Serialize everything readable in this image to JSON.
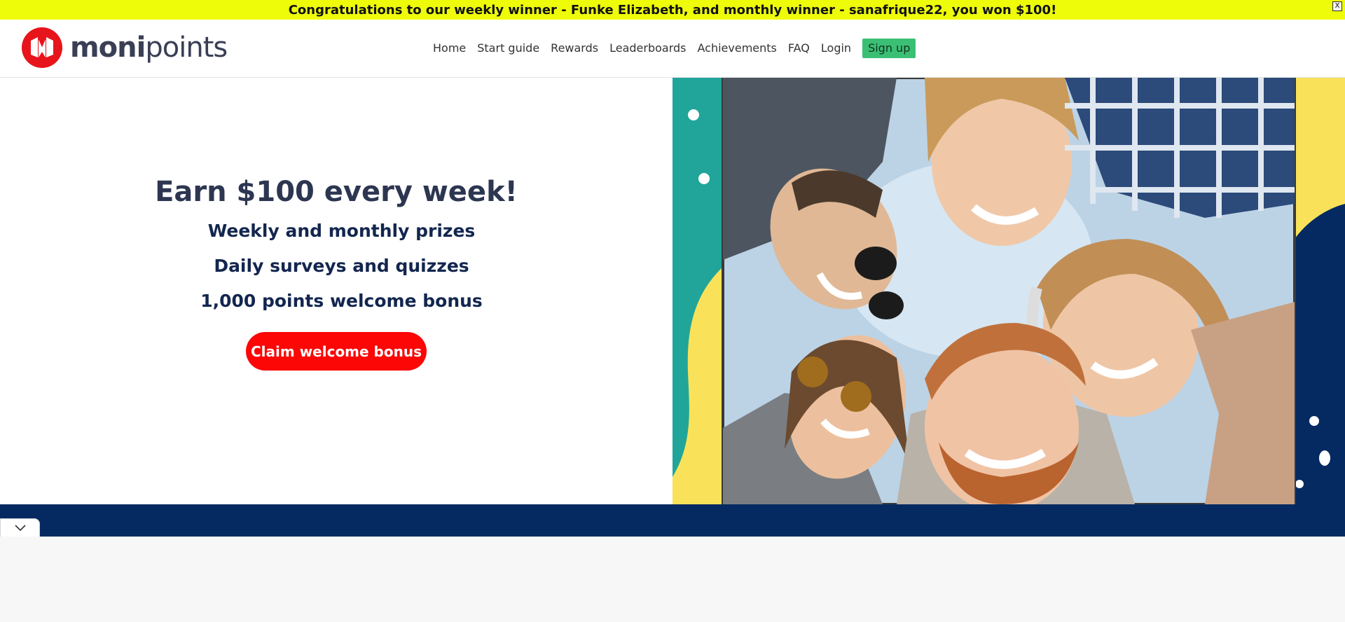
{
  "announcement": {
    "text": "Congratulations to our weekly winner - Funke Elizabeth, and monthly winner - sanafrique22, you won $100!",
    "close_label": "X"
  },
  "brand": {
    "name_bold": "moni",
    "name_light": "points",
    "logo_color": "#e8141b",
    "text_color": "#3a3f55"
  },
  "nav": {
    "items": [
      "Home",
      "Start guide",
      "Rewards",
      "Leaderboards",
      "Achievements",
      "FAQ",
      "Login"
    ],
    "signup": "Sign up",
    "signup_color": "#3bbf75"
  },
  "hero": {
    "headline": "Earn $100 every week!",
    "features": [
      "Weekly and monthly prizes",
      "Daily surveys and quizzes",
      "1,000 points welcome bonus"
    ],
    "cta_label": "Claim welcome bonus",
    "cta_color": "#fc0606"
  },
  "colors": {
    "teal": "#21a59a",
    "yellow": "#f9e25a",
    "navy": "#052a61",
    "sky": "#bcd3e6"
  },
  "icons": {
    "collapse": "chevron-down-icon"
  }
}
